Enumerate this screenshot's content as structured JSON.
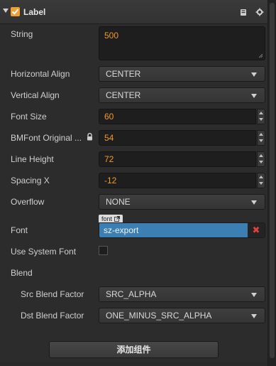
{
  "component": {
    "title": "Label",
    "enabled": true
  },
  "fields": {
    "string": {
      "label": "String",
      "value": "500"
    },
    "horizontal_align": {
      "label": "Horizontal Align",
      "value": "CENTER"
    },
    "vertical_align": {
      "label": "Vertical Align",
      "value": "CENTER"
    },
    "font_size": {
      "label": "Font Size",
      "value": "60"
    },
    "bmfont_original_size": {
      "label": "BMFont Original ...",
      "value": "54"
    },
    "line_height": {
      "label": "Line Height",
      "value": "72"
    },
    "spacing_x": {
      "label": "Spacing X",
      "value": "-12"
    },
    "overflow": {
      "label": "Overflow",
      "value": "NONE"
    },
    "font": {
      "label": "Font",
      "tag": "font",
      "value": "sz-export",
      "clear_glyph": "✖"
    },
    "use_system_font": {
      "label": "Use System Font",
      "checked": false
    },
    "blend": {
      "label": "Blend"
    },
    "src_blend_factor": {
      "label": "Src Blend Factor",
      "value": "SRC_ALPHA"
    },
    "dst_blend_factor": {
      "label": "Dst Blend Factor",
      "value": "ONE_MINUS_SRC_ALPHA"
    }
  },
  "footer": {
    "add_component_label": "添加组件"
  },
  "icons": {
    "collapse": "triangle-down",
    "enable_checkbox": "checkmark",
    "help": "book-icon",
    "settings": "gear-icon",
    "lock": "lock-icon",
    "open_asset": "external-link-icon"
  },
  "colors": {
    "accent": "#f0a030",
    "value_text": "#f19a2a",
    "selected_asset": "#3b7fb3",
    "clear": "#e04040"
  }
}
